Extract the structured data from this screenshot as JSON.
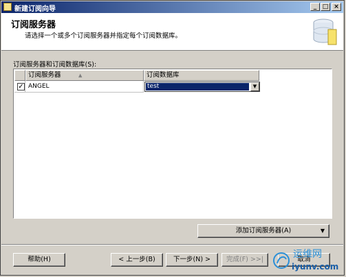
{
  "window": {
    "title": "新建订阅向导",
    "buttons": {
      "minimize": "_",
      "maximize": "□",
      "close": "×"
    }
  },
  "header": {
    "title": "订阅服务器",
    "subtitle": "请选择一个或多个订阅服务器并指定每个订阅数据库。"
  },
  "grid": {
    "label": "订阅服务器和订阅数据库(S):",
    "columns": [
      "订阅服务器",
      "订阅数据库"
    ],
    "sort_indicator": "▲",
    "rows": [
      {
        "checked": true,
        "server": "ANGEL",
        "database": "test"
      }
    ]
  },
  "actions": {
    "add_subscriber": "添加订阅服务器(A)",
    "add_subscriber_arrow": "▼"
  },
  "footer": {
    "help": "帮助(H)",
    "back": "< 上一步(B)",
    "next": "下一步(N) >",
    "finish": "完成(F) >>|",
    "cancel": "取消"
  },
  "watermark": {
    "cn": "运维网",
    "url": "iyunv.com"
  }
}
